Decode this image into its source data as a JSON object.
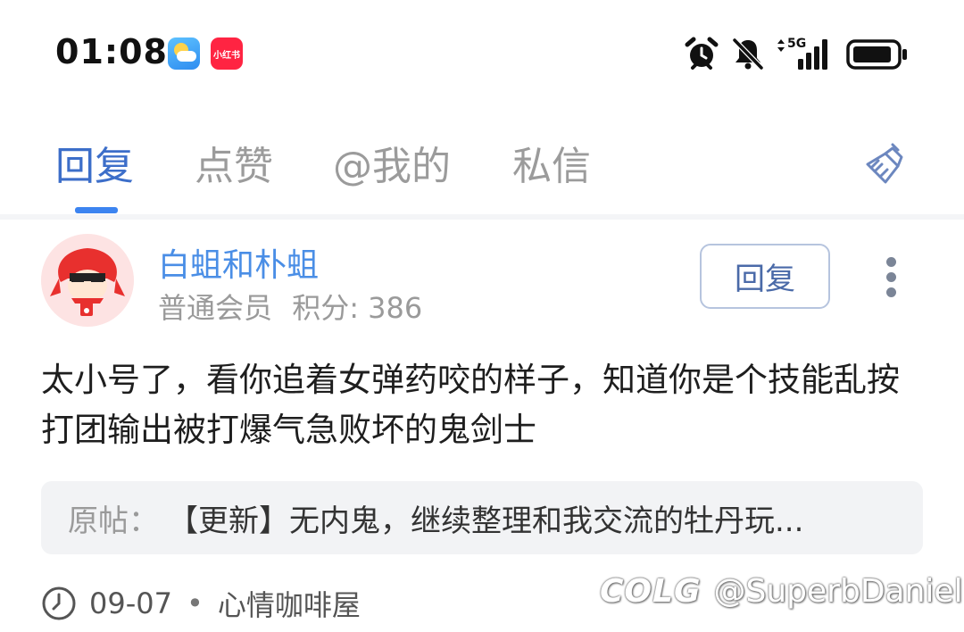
{
  "status_bar": {
    "time": "01:08",
    "apps": [
      "weather-icon",
      "xiaohongshu-icon"
    ],
    "xhs_text": "小红书",
    "network": "5G",
    "icons": [
      "alarm-icon",
      "mute-icon",
      "signal-icon",
      "battery-icon"
    ]
  },
  "tabs": [
    {
      "label": "回复",
      "active": true
    },
    {
      "label": "点赞",
      "active": false
    },
    {
      "label": "@我的",
      "active": false
    },
    {
      "label": "私信",
      "active": false
    }
  ],
  "post": {
    "username": "白蛆和朴蛆",
    "member_level": "普通会员",
    "points_label": "积分: 386",
    "reply_button": "回复",
    "content": "太小号了，看你追着女弹药咬的样子，知道你是个技能乱按打团输出被打爆气急败坏的鬼剑士",
    "origin_label": "原帖：",
    "origin_title": "【更新】无内鬼，继续整理和我交流的牡丹玩...",
    "date": "09-07",
    "forum": "心情咖啡屋"
  },
  "watermark": {
    "logo": "COLG",
    "handle": "@SuperbDaniel"
  },
  "colors": {
    "accent": "#3c6ec9",
    "username": "#4a8ee6",
    "muted": "#9a9a9a"
  }
}
